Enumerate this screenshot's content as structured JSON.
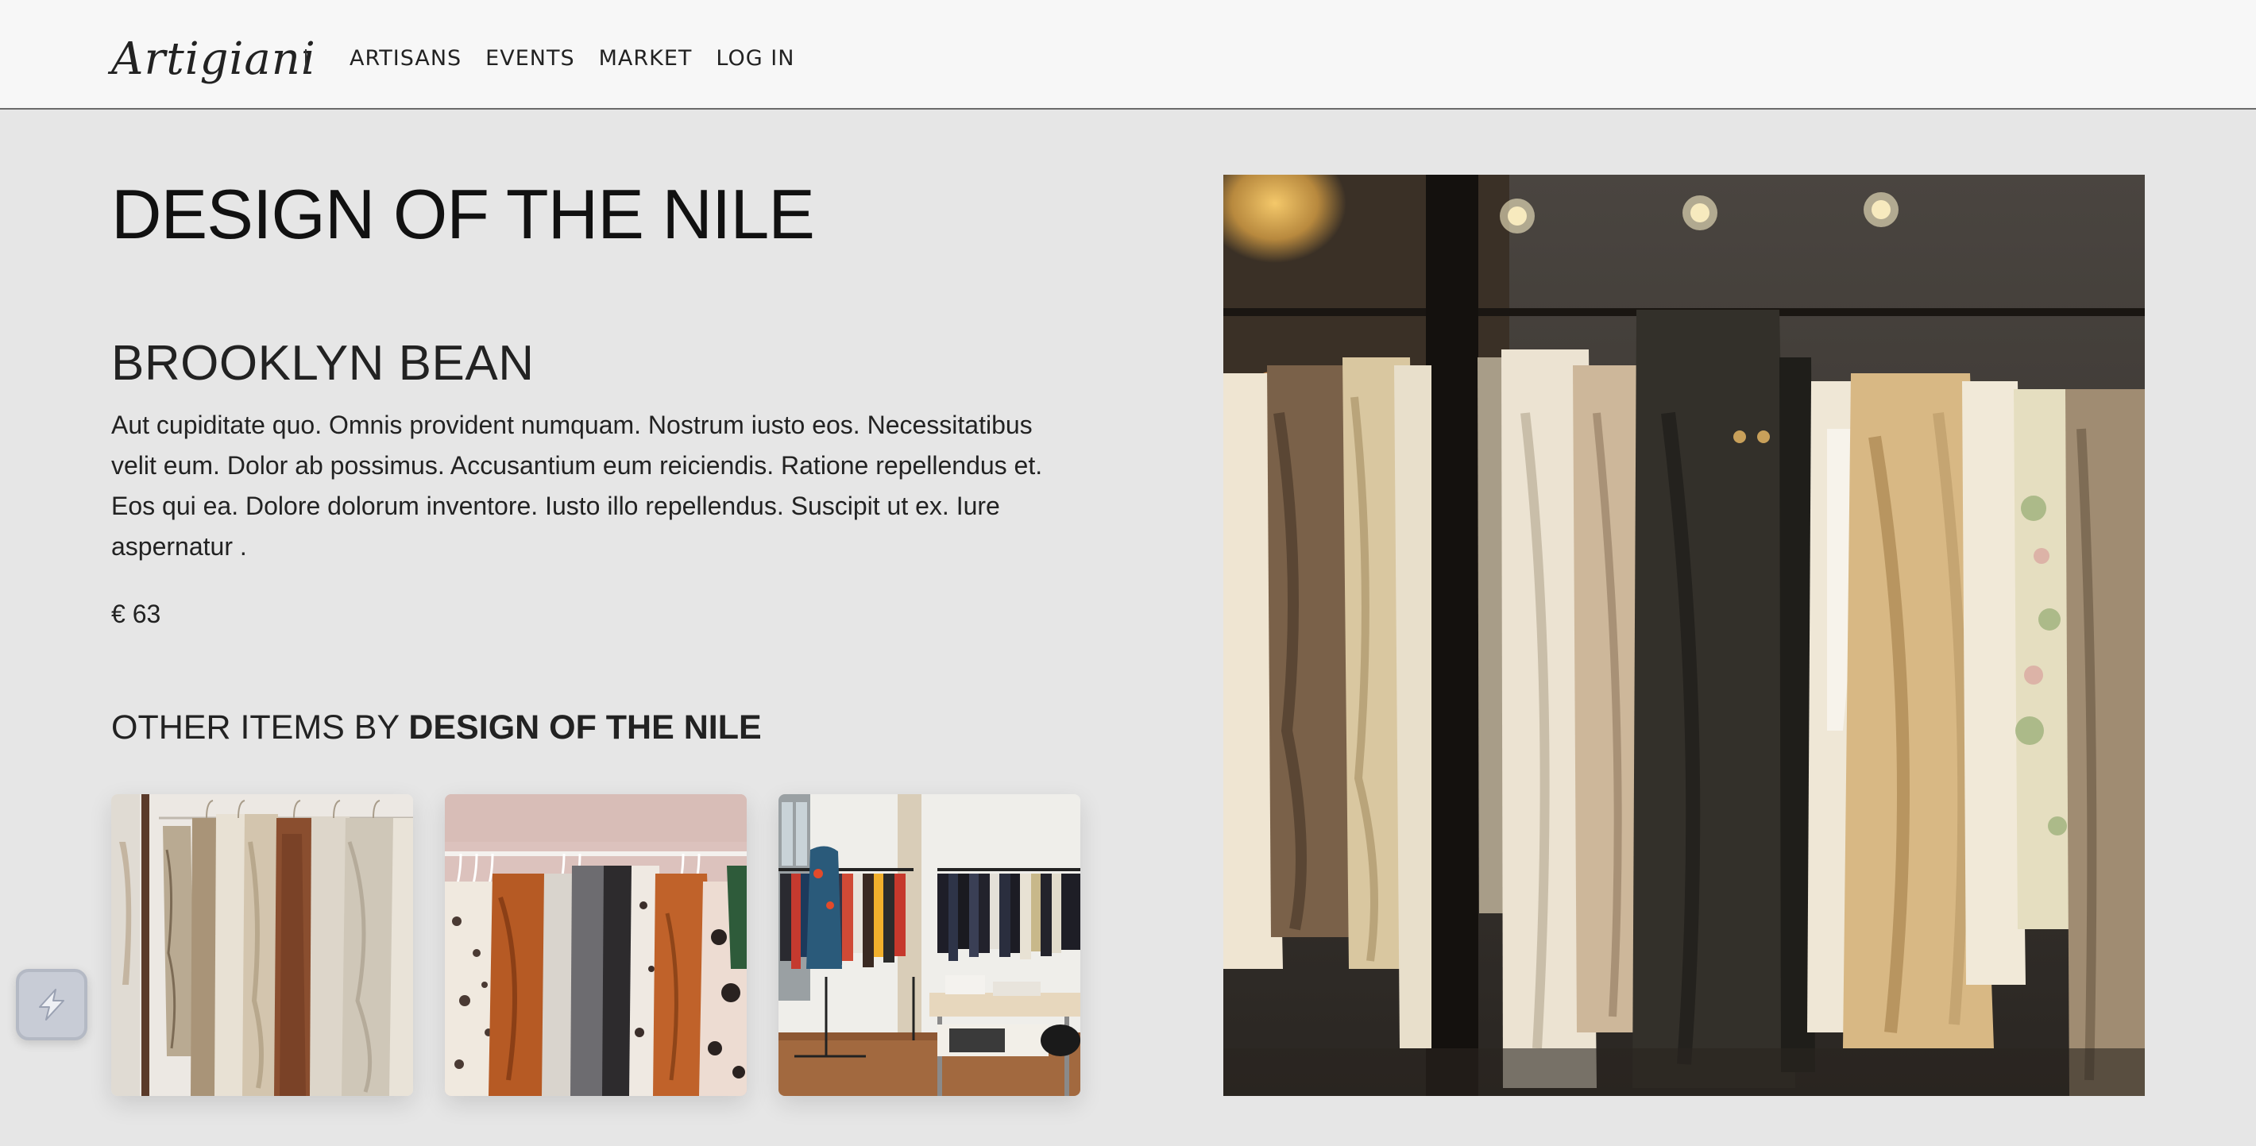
{
  "header": {
    "logo": "Artigiani",
    "separator": "|",
    "nav": [
      {
        "label": "ARTISANS"
      },
      {
        "label": "EVENTS"
      },
      {
        "label": "MARKET"
      },
      {
        "label": "LOG IN"
      }
    ]
  },
  "product": {
    "maker": "DESIGN OF THE NILE",
    "title": "BROOKLYN BEAN",
    "description": "Aut cupiditate quo. Omnis provident numquam. Nostrum iusto eos. Necessitatibus velit eum. Dolor ab possimus. Accusantium eum reiciendis. Ratione repellendus et. Eos qui ea. Dolore dolorum inventore. Iusto illo repellendus. Suscipit ut ex. Iure aspernatur .",
    "price": "€ 63"
  },
  "other_items": {
    "heading_prefix": "OTHER ITEMS BY",
    "heading_maker": "DESIGN OF THE NILE"
  },
  "images": {
    "main": "clothing-rack-photo",
    "thumbs": [
      "knit-sweaters-photo",
      "patterned-blouses-photo",
      "boutique-interior-photo"
    ]
  },
  "colors": {
    "background": "#e6e6e6",
    "header_bg": "#f7f7f7",
    "text": "#222222"
  },
  "widget": {
    "icon": "lightning-bolt-icon"
  }
}
